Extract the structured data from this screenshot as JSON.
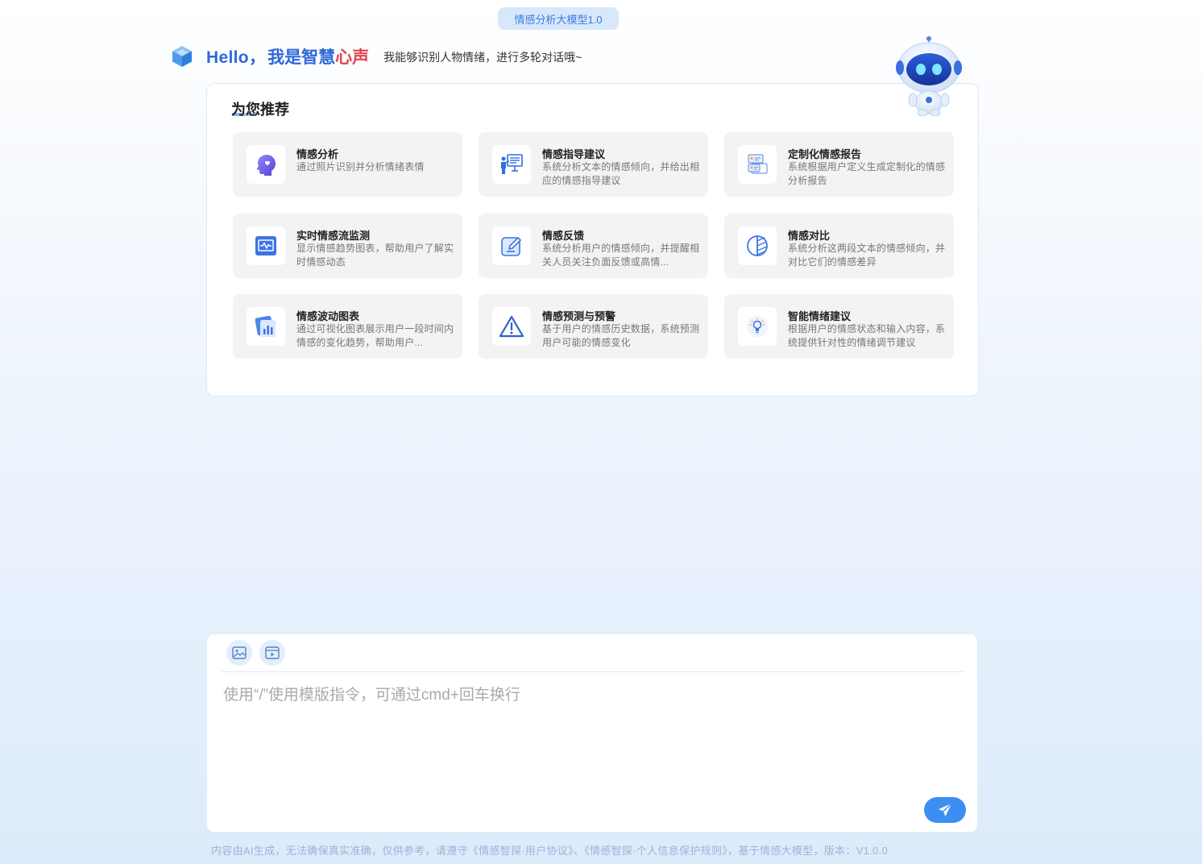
{
  "version_badge": "情感分析大模型1.0",
  "header": {
    "hello": "Hello，",
    "brand_prefix": "我是",
    "brand_mid": "智慧",
    "brand_end": "心声",
    "tagline": "我能够识别人物情绪，进行多轮对话哦~"
  },
  "recommend": {
    "title": "为您推荐",
    "items": [
      {
        "title": "情感分析",
        "desc": "通过照片识别并分析情绪表情",
        "icon": "face-profile-icon"
      },
      {
        "title": "情感指导建议",
        "desc": "系统分析文本的情感倾向，并给出相应的情感指导建议",
        "icon": "presentation-icon"
      },
      {
        "title": "定制化情感报告",
        "desc": "系统根据用户定义生成定制化的情感分析报告",
        "icon": "report-cards-icon"
      },
      {
        "title": "实时情感流监测",
        "desc": "显示情感趋势图表，帮助用户了解实时情感动态",
        "icon": "pulse-monitor-icon"
      },
      {
        "title": "情感反馈",
        "desc": "系统分析用户的情感倾向，并提醒相关人员关注负面反馈或高情...",
        "icon": "edit-square-icon"
      },
      {
        "title": "情感对比",
        "desc": "系统分析这两段文本的情感倾向，并对比它们的情感差异",
        "icon": "compare-circle-icon"
      },
      {
        "title": "情感波动图表",
        "desc": "通过可视化图表展示用户一段时间内情感的变化趋势，帮助用户...",
        "icon": "bar-chart-card-icon"
      },
      {
        "title": "情感预测与预警",
        "desc": "基于用户的情感历史数据，系统预测用户可能的情感变化",
        "icon": "warning-triangle-icon"
      },
      {
        "title": "智能情绪建议",
        "desc": "根据用户的情感状态和输入内容，系统提供针对性的情绪调节建议",
        "icon": "lightbulb-icon"
      }
    ]
  },
  "composer": {
    "placeholder": "使用“/”使用模版指令，可通过cmd+回车换行",
    "value": ""
  },
  "footer": "内容由AI生成，无法确保真实准确，仅供参考，请遵守《情感智探·用户协议》、《情感智探·个人信息保护规则》，基于情感大模型，版本：V1.0.0"
}
